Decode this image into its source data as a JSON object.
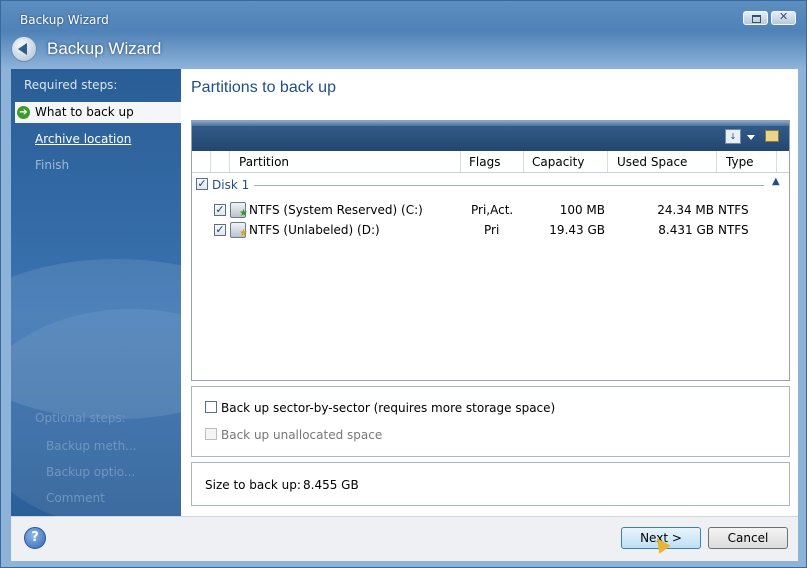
{
  "window": {
    "title": "Backup Wizard",
    "heading": "Backup Wizard"
  },
  "sidebar": {
    "required_header": "Required steps:",
    "items": [
      {
        "label": "What to back up",
        "state": "current"
      },
      {
        "label": "Archive location",
        "state": "link"
      },
      {
        "label": "Finish",
        "state": "disabled"
      }
    ],
    "optional_header": "Optional steps:",
    "optional_items": [
      "Backup meth...",
      "Backup optio...",
      "Comment"
    ]
  },
  "content": {
    "title": "Partitions to back up",
    "columns": [
      "Partition",
      "Flags",
      "Capacity",
      "Used Space",
      "Type"
    ],
    "group": {
      "label": "Disk 1",
      "checked": true
    },
    "partitions": [
      {
        "name": "NTFS (System Reserved) (C:)",
        "flags": "Pri,Act.",
        "capacity": "100 MB",
        "used": "24.34 MB",
        "type": "NTFS",
        "checked": true,
        "badge": "green"
      },
      {
        "name": "NTFS (Unlabeled) (D:)",
        "flags": "Pri",
        "capacity": "19.43 GB",
        "used": "8.431 GB",
        "type": "NTFS",
        "checked": true,
        "badge": "yellow"
      }
    ],
    "options": {
      "sector_by_sector": "Back up sector-by-sector (requires more storage space)",
      "unallocated": "Back up unallocated space"
    },
    "size_label": "Size to back up:",
    "size_value": "8.455 GB"
  },
  "footer": {
    "next_label": "Next >",
    "cancel_label": "Cancel",
    "help_glyph": "?"
  },
  "colors": {
    "accent": "#1f4f87",
    "sidebar": "#2e649e"
  }
}
